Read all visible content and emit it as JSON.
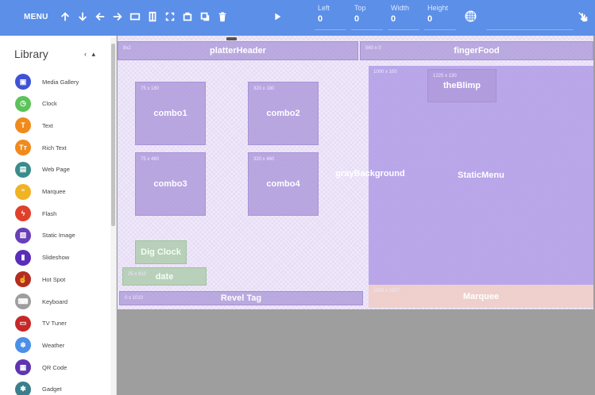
{
  "toolbar": {
    "menu_label": "MENU",
    "fields": [
      {
        "label": "Left",
        "value": "0"
      },
      {
        "label": "Top",
        "value": "0"
      },
      {
        "label": "Width",
        "value": "0"
      },
      {
        "label": "Height",
        "value": "0"
      }
    ],
    "icons": [
      "arrow-up-icon",
      "arrow-down-icon",
      "arrow-left-icon",
      "arrow-right-icon",
      "stretch-horizontal-icon",
      "stretch-vertical-icon",
      "fit-icon",
      "bring-front-icon",
      "send-back-icon",
      "delete-icon",
      "play-icon",
      "checkerboard-icon",
      "no-touch-icon"
    ]
  },
  "library": {
    "title": "Library",
    "controls": "‹ ▴",
    "items": [
      {
        "label": "Media Gallery",
        "color": "#3f51d6",
        "icon": "media-gallery-icon",
        "glyph": "▣"
      },
      {
        "label": "Clock",
        "color": "#5cc35a",
        "icon": "clock-icon",
        "glyph": "◷"
      },
      {
        "label": "Text",
        "color": "#f08a1c",
        "icon": "text-icon",
        "glyph": "T"
      },
      {
        "label": "Rich Text",
        "color": "#f08a1c",
        "icon": "rich-text-icon",
        "glyph": "Tᴛ"
      },
      {
        "label": "Web Page",
        "color": "#3a8c8a",
        "icon": "web-page-icon",
        "glyph": "▤"
      },
      {
        "label": "Marquee",
        "color": "#f0b323",
        "icon": "marquee-icon",
        "glyph": "”"
      },
      {
        "label": "Flash",
        "color": "#e0402a",
        "icon": "flash-icon",
        "glyph": "ϟ"
      },
      {
        "label": "Static Image",
        "color": "#6a3eb8",
        "icon": "static-image-icon",
        "glyph": "▧"
      },
      {
        "label": "Slideshow",
        "color": "#5a2db8",
        "icon": "slideshow-icon",
        "glyph": "▮"
      },
      {
        "label": "Hot Spot",
        "color": "#b42c22",
        "icon": "hot-spot-icon",
        "glyph": "☝"
      },
      {
        "label": "Keyboard",
        "color": "#9e9e9e",
        "icon": "keyboard-icon",
        "glyph": "⌨"
      },
      {
        "label": "TV Tuner",
        "color": "#c62828",
        "icon": "tv-tuner-icon",
        "glyph": "▭"
      },
      {
        "label": "Weather",
        "color": "#4a8fe8",
        "icon": "weather-icon",
        "glyph": "❄"
      },
      {
        "label": "QR Code",
        "color": "#5e35b1",
        "icon": "qr-code-icon",
        "glyph": "▦"
      },
      {
        "label": "Gadget",
        "color": "#3a7f8a",
        "icon": "gadget-icon",
        "glyph": "✱"
      }
    ]
  },
  "canvas": {
    "zones": [
      {
        "key": "platterHeader",
        "name": "platterHeader",
        "size": "8x2"
      },
      {
        "key": "fingerFood",
        "name": "fingerFood",
        "size": "560 x 0"
      },
      {
        "key": "combo1",
        "name": "combo1",
        "size": "75 x 180"
      },
      {
        "key": "combo2",
        "name": "combo2",
        "size": "320 x 180"
      },
      {
        "key": "combo3",
        "name": "combo3",
        "size": "75 x 460"
      },
      {
        "key": "combo4",
        "name": "combo4",
        "size": "320 x 460"
      },
      {
        "key": "grayBackground",
        "name": "grayBackground",
        "size": ""
      },
      {
        "key": "staticMenu",
        "name": "StaticMenu",
        "size": "1000 x 100"
      },
      {
        "key": "theBlimp",
        "name": "theBlimp",
        "size": "1225 x 130"
      },
      {
        "key": "digClock",
        "name": "Dig Clock",
        "size": ""
      },
      {
        "key": "date",
        "name": "date",
        "size": "25 x 910"
      },
      {
        "key": "revelTag",
        "name": "Revel Tag",
        "size": "0 x 1010"
      },
      {
        "key": "marquee",
        "name": "Marquee",
        "size": "1000 x 1007"
      }
    ]
  }
}
